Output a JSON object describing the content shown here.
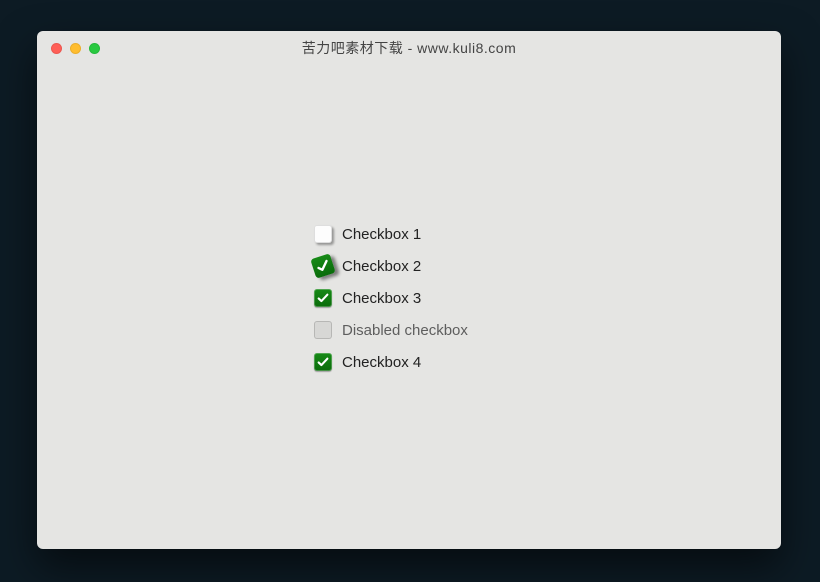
{
  "window": {
    "title": "苦力吧素材下载 - www.kuli8.com"
  },
  "colors": {
    "checkbox_checked": "#128a12",
    "checkbox_tick": "#ffffff"
  },
  "checkboxes": [
    {
      "id": "cb1",
      "label": "Checkbox 1",
      "state": "unchecked",
      "disabled": false,
      "tilt": false
    },
    {
      "id": "cb2",
      "label": "Checkbox 2",
      "state": "checked",
      "disabled": false,
      "tilt": true
    },
    {
      "id": "cb3",
      "label": "Checkbox 3",
      "state": "checked",
      "disabled": false,
      "tilt": false
    },
    {
      "id": "cb4",
      "label": "Disabled checkbox",
      "state": "unchecked",
      "disabled": true,
      "tilt": false
    },
    {
      "id": "cb5",
      "label": "Checkbox 4",
      "state": "checked",
      "disabled": false,
      "tilt": false
    }
  ]
}
